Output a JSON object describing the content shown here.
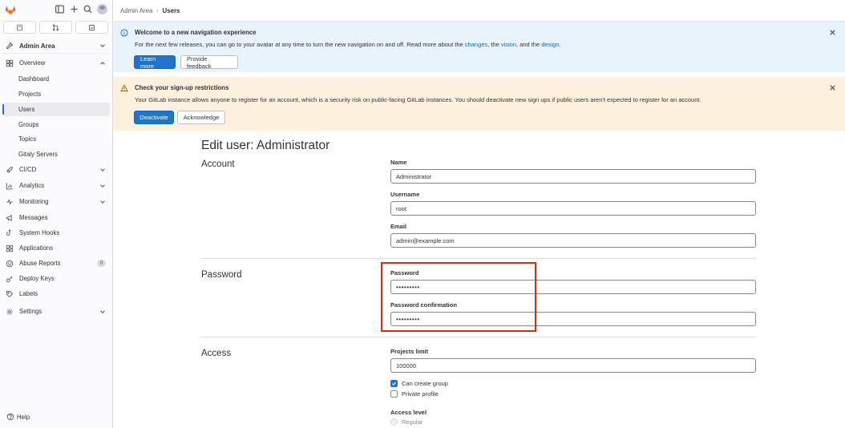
{
  "sidebar": {
    "context": "Admin Area",
    "items": [
      {
        "label": "Overview"
      },
      {
        "label": "Dashboard"
      },
      {
        "label": "Projects"
      },
      {
        "label": "Users"
      },
      {
        "label": "Groups"
      },
      {
        "label": "Topics"
      },
      {
        "label": "Gitaly Servers"
      },
      {
        "label": "CI/CD"
      },
      {
        "label": "Analytics"
      },
      {
        "label": "Monitoring"
      },
      {
        "label": "Messages"
      },
      {
        "label": "System Hooks"
      },
      {
        "label": "Applications"
      },
      {
        "label": "Abuse Reports",
        "badge": "0"
      },
      {
        "label": "Deploy Keys"
      },
      {
        "label": "Labels"
      },
      {
        "label": "Settings"
      }
    ],
    "help": "Help"
  },
  "breadcrumb": {
    "parent": "Admin Area",
    "separator": "›",
    "current": "Users"
  },
  "alerts": {
    "nav": {
      "title": "Welcome to a new navigation experience",
      "body_prefix": "For the next few releases, you can go to your avatar at any time to turn the new navigation on and off. Read more about the ",
      "link1": "changes",
      "mid1": ", the ",
      "link2": "vision",
      "mid2": ", and the ",
      "link3": "design",
      "end": ".",
      "primary": "Learn more",
      "secondary": "Provide feedback"
    },
    "signup": {
      "title": "Check your sign-up restrictions",
      "body": "Your GitLab instance allows anyone to register for an account, which is a security risk on public-facing GitLab instances. You should deactivate new sign ups if public users aren't expected to register for an account.",
      "primary": "Deactivate",
      "secondary": "Acknowledge"
    }
  },
  "form": {
    "title": "Edit user: Administrator",
    "account": {
      "section": "Account",
      "name_label": "Name",
      "name_value": "Administrator",
      "username_label": "Username",
      "username_value": "root",
      "email_label": "Email",
      "email_value": "admin@example.com"
    },
    "password": {
      "section": "Password",
      "password_label": "Password",
      "password_value": "•••••••••",
      "confirm_label": "Password confirmation",
      "confirm_value": "•••••••••"
    },
    "access": {
      "section": "Access",
      "projects_limit_label": "Projects limit",
      "projects_limit_value": "100000",
      "can_create_group": "Can create group",
      "private_profile": "Private profile",
      "access_level_label": "Access level",
      "regular": "Regular"
    }
  },
  "colors": {
    "accent": "#1f75cb",
    "highlight": "#dd2b0e",
    "info_bg": "#e9f3fc",
    "warn_bg": "#fdf1dd"
  }
}
